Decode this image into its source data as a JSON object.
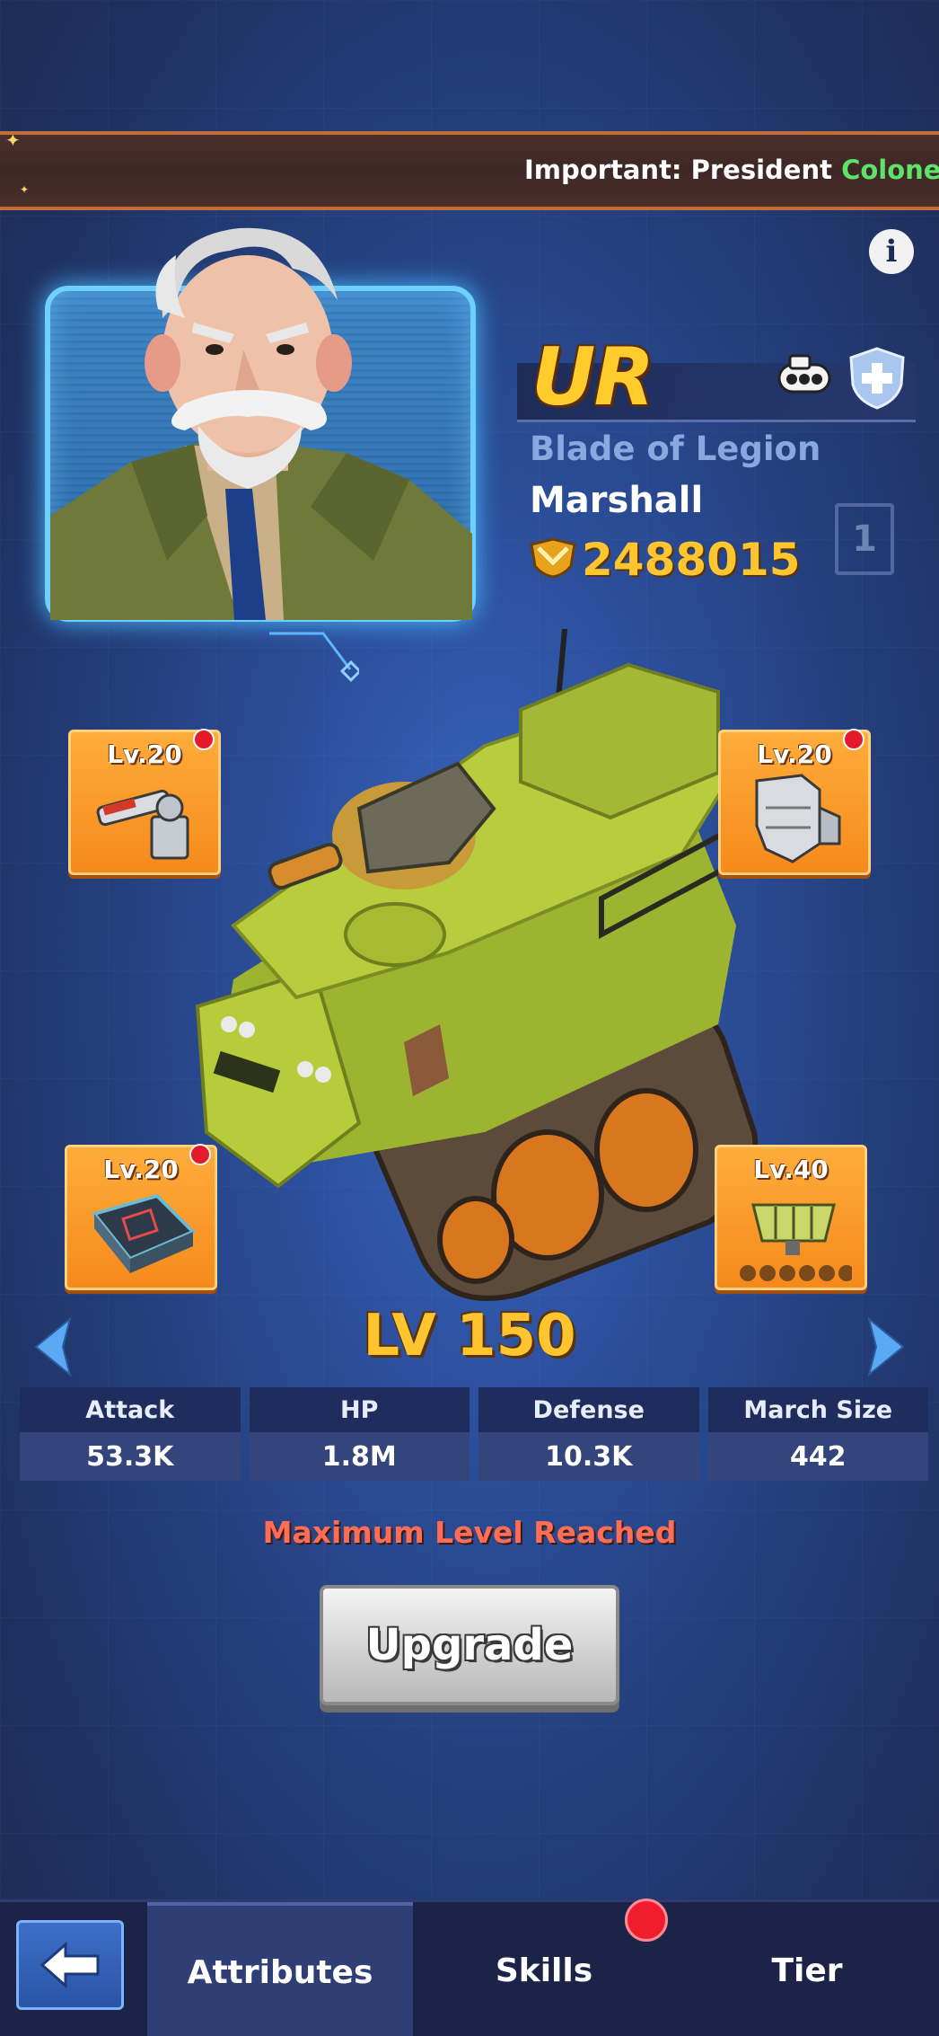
{
  "banner": {
    "prefix": "Important: President ",
    "highlight": "Colonel Ya"
  },
  "icons": {
    "info": "info-icon",
    "back": "arrow-left-icon",
    "power": "power-crest-icon",
    "tank_badge": "tank-type-icon",
    "shield_badge": "shield-plus-icon"
  },
  "hero": {
    "rarity": "UR",
    "title": "Blade of Legion",
    "name": "Marshall",
    "power": "2488015",
    "slot_number": "1"
  },
  "equipment": [
    {
      "level": "Lv.20",
      "item": "cannon",
      "alert": true
    },
    {
      "level": "Lv.20",
      "item": "armor-plate",
      "alert": true
    },
    {
      "level": "Lv.20",
      "item": "radar-chip",
      "alert": true
    },
    {
      "level": "Lv.40",
      "item": "engine",
      "alert": false
    }
  ],
  "level": "LV 150",
  "stats": [
    {
      "label": "Attack",
      "value": "53.3K"
    },
    {
      "label": "HP",
      "value": "1.8M"
    },
    {
      "label": "Defense",
      "value": "10.3K"
    },
    {
      "label": "March Size",
      "value": "442"
    }
  ],
  "status_message": "Maximum Level Reached",
  "upgrade_label": "Upgrade",
  "tabs": [
    {
      "label": "Attributes",
      "active": true
    },
    {
      "label": "Skills",
      "active": false,
      "alert": true
    },
    {
      "label": "Tier",
      "active": false
    }
  ],
  "colors": {
    "accent_gold": "#ffc531",
    "rarity_gold": "#ffcc2b",
    "equip_orange": "#f58a1c",
    "alert_red": "#e6192b",
    "warning_text": "#ff6d54",
    "highlight_green": "#5ee36a"
  }
}
